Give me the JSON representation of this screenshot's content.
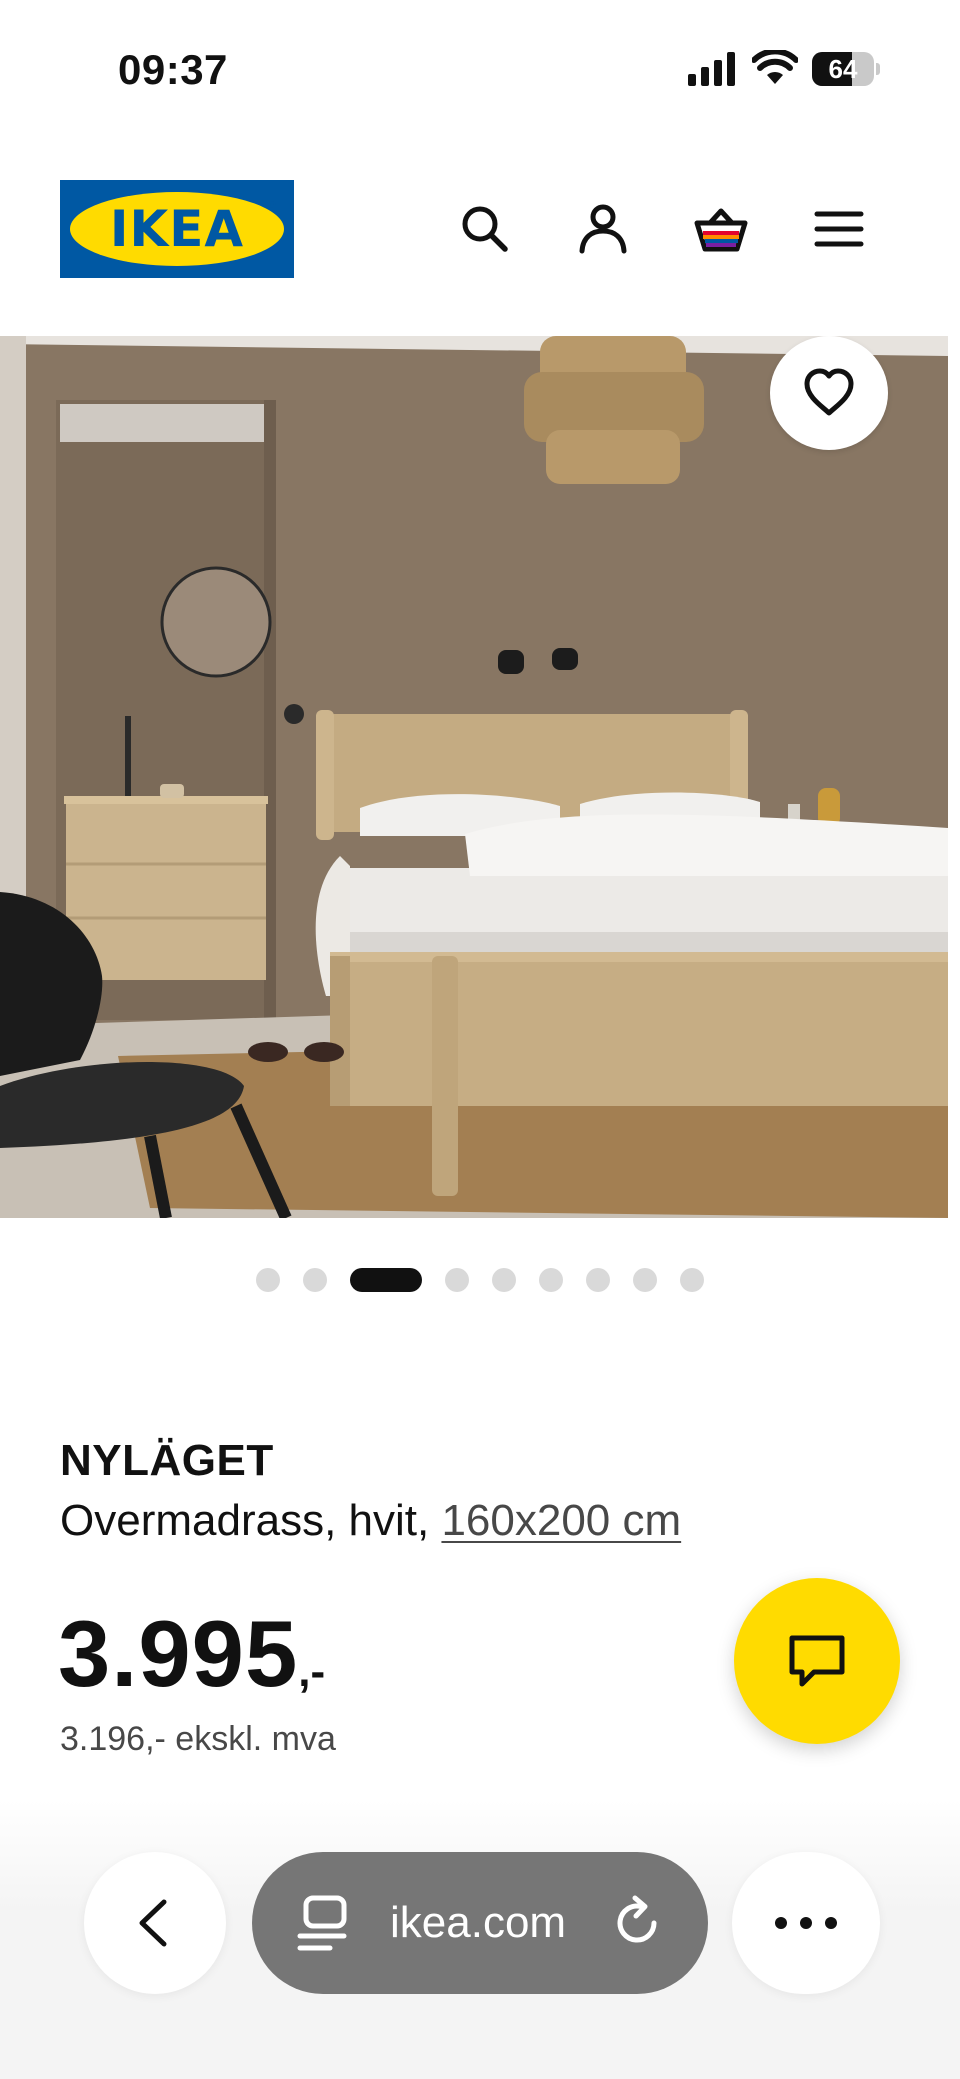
{
  "status_bar": {
    "time": "09:37",
    "battery": "64",
    "battery_level": 0.64
  },
  "header": {
    "logo_text": "IKEA",
    "logo_reg": "®",
    "icons": [
      "search-icon",
      "account-icon",
      "basket-icon",
      "menu-icon"
    ]
  },
  "hero": {
    "image_description_icon": "bedroom-photo",
    "favorite_icon": "heart-icon",
    "carousel": {
      "count": 9,
      "active_index": 2
    }
  },
  "product": {
    "name": "NYLÄGET",
    "description": "Overmadrass, hvit, ",
    "size": "160x200 cm",
    "price": "3.995",
    "price_suffix": ",-",
    "price_ex_vat": "3.196,- ekskl. mva"
  },
  "chat": {
    "icon": "chat-icon"
  },
  "browser": {
    "url": "ikea.com",
    "icons": [
      "back-arrow-icon",
      "tabs-icon",
      "reload-icon",
      "more-icon"
    ]
  },
  "colors": {
    "ikea_blue": "#0058a3",
    "ikea_yellow": "#ffdb00",
    "text": "#111111",
    "muted": "#484848",
    "url_pill": "#767676"
  }
}
